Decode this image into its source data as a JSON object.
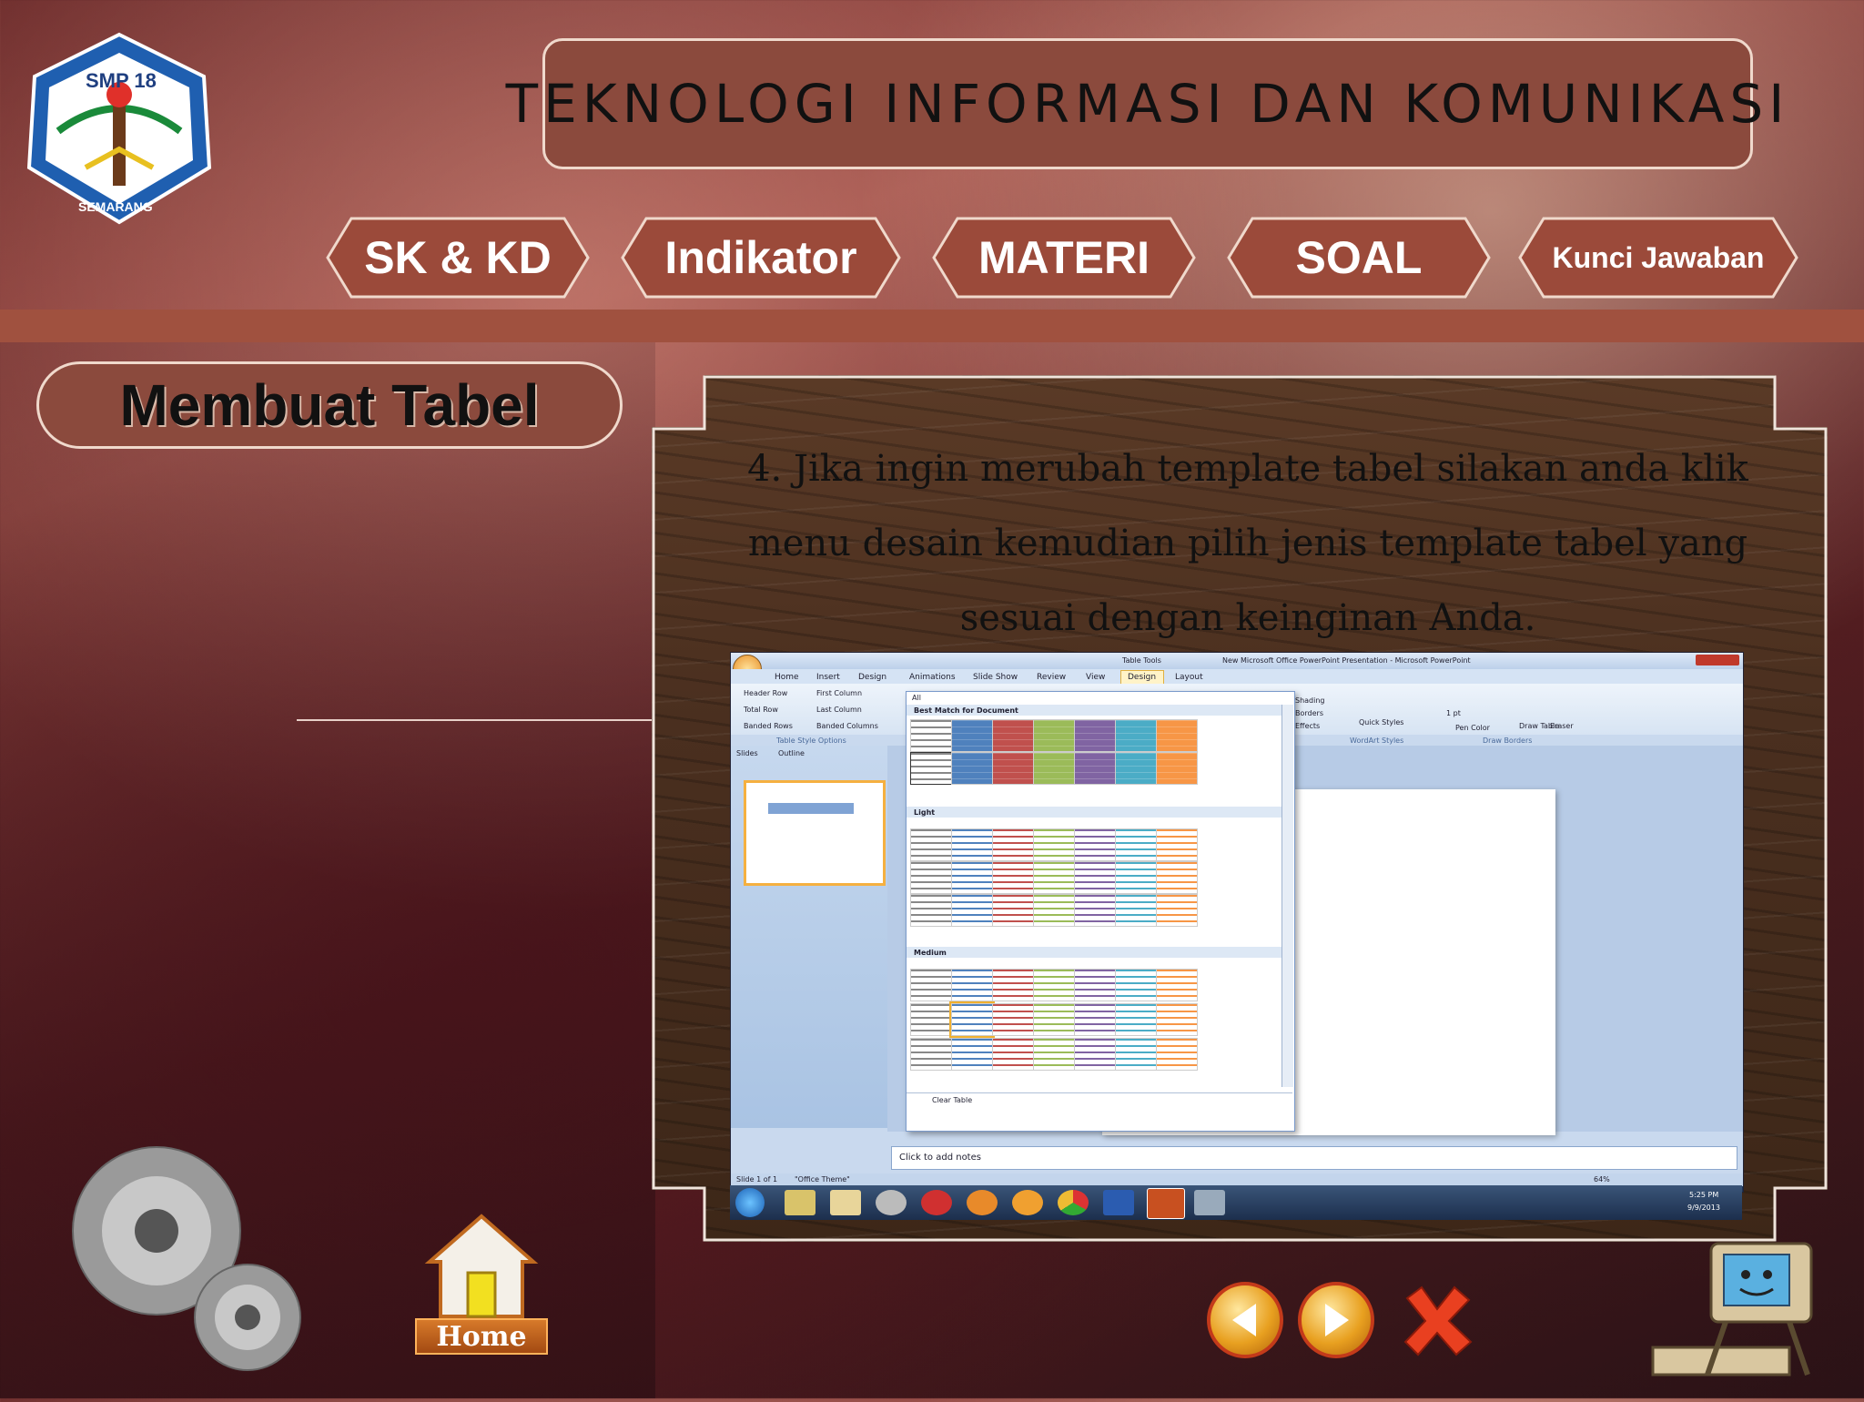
{
  "header": {
    "title": "TEKNOLOGI INFORMASI DAN KOMUNIKASI",
    "logo": {
      "top_text": "SMP 18",
      "bottom_text": "SEMARANG"
    }
  },
  "nav": [
    {
      "label": "SK & KD"
    },
    {
      "label": "Indikator"
    },
    {
      "label": "MATERI"
    },
    {
      "label": "SOAL"
    },
    {
      "label": "Kunci Jawaban"
    }
  ],
  "section": {
    "title": "Membuat Tabel"
  },
  "content": {
    "step_text": "4. Jika ingin merubah template tabel silakan anda klik menu desain kemudian pilih jenis template tabel yang sesuai dengan keinginan Anda."
  },
  "screenshot": {
    "window_title": "New Microsoft Office PowerPoint Presentation - Microsoft PowerPoint",
    "context_tab": "Table Tools",
    "tabs": [
      "Home",
      "Insert",
      "Design",
      "Animations",
      "Slide Show",
      "Review",
      "View",
      "Design",
      "Layout"
    ],
    "style_options": [
      "Header Row",
      "First Column",
      "Total Row",
      "Last Column",
      "Banded Rows",
      "Banded Columns"
    ],
    "style_options_group": "Table Style Options",
    "gallery_filter": "All",
    "gallery_sections": [
      "Best Match for Document",
      "Light",
      "Medium"
    ],
    "clear_table": "Clear Table",
    "right_groups": [
      "Shading",
      "Borders",
      "Effects",
      "Quick Styles",
      "WordArt Styles",
      "1 pt",
      "Pen Color",
      "Draw Table",
      "Eraser",
      "Draw Borders"
    ],
    "pane_tabs": [
      "Slides",
      "Outline"
    ],
    "notes_placeholder": "Click to add notes",
    "status_left": "Slide 1 of 1",
    "status_theme": "\"Office Theme\"",
    "zoom": "64%",
    "clock_time": "5:25 PM",
    "clock_date": "9/9/2013"
  },
  "footer": {
    "home_label": "Home"
  },
  "colors": {
    "accent": "#8b4a3d",
    "band": "#a0513f",
    "nav_fill": "#9b4a3a"
  }
}
